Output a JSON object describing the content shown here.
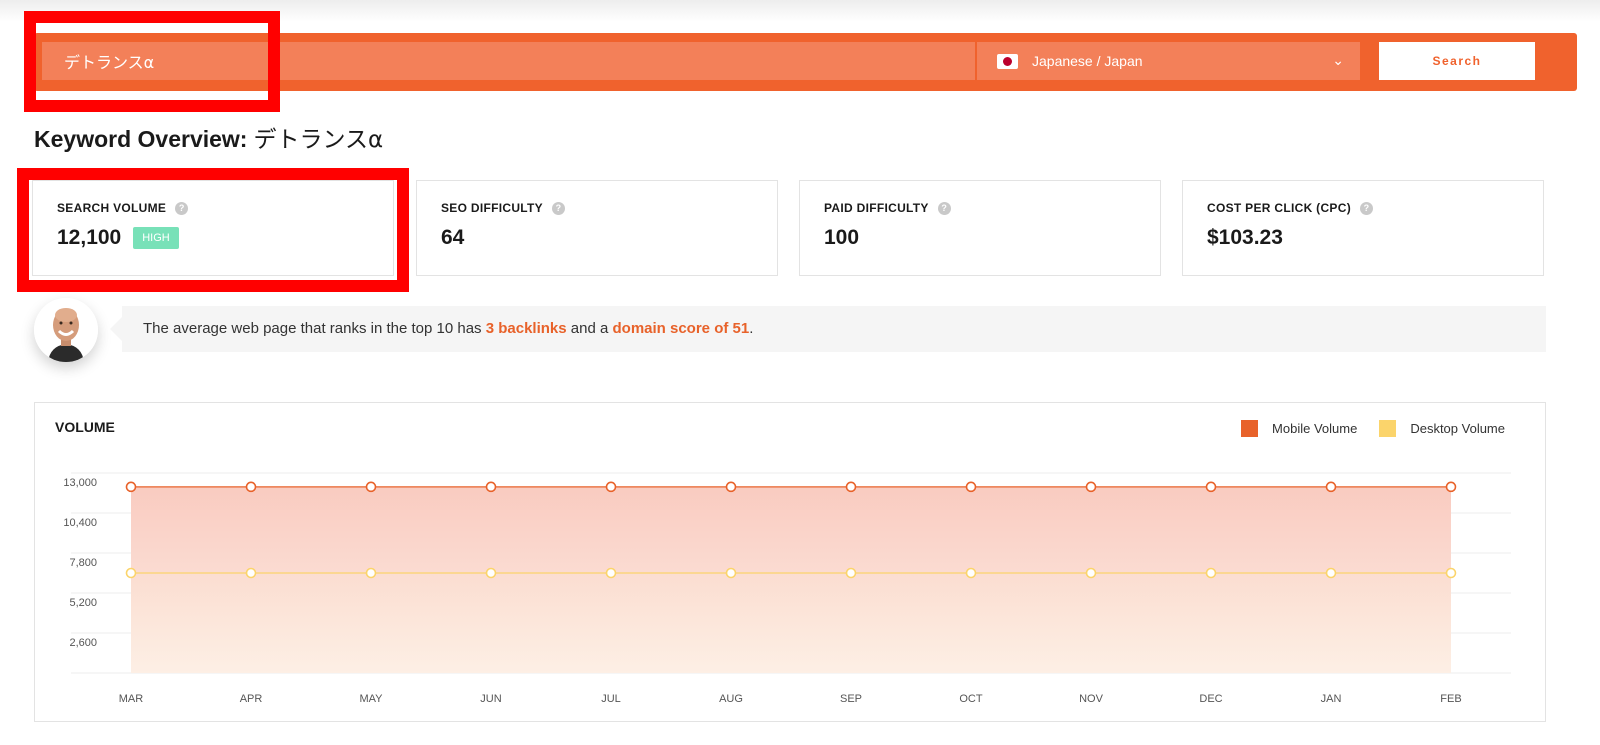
{
  "search": {
    "keyword": "デトランスα",
    "language": "Japanese / Japan",
    "button_label": "Search"
  },
  "title": {
    "prefix": "Keyword Overview:",
    "keyword": "デトランスα"
  },
  "metrics": [
    {
      "label": "SEARCH VOLUME",
      "value": "12,100",
      "badge": "HIGH"
    },
    {
      "label": "SEO DIFFICULTY",
      "value": "64"
    },
    {
      "label": "PAID DIFFICULTY",
      "value": "100"
    },
    {
      "label": "COST PER CLICK (CPC)",
      "value": "$103.23"
    }
  ],
  "tip": {
    "prefix": "The average web page that ranks in the top 10 has ",
    "backlinks": "3 backlinks",
    "middle": " and a ",
    "domain_score": "domain score of 51",
    "suffix": "."
  },
  "colors": {
    "accent": "#f0622d",
    "mobile": "#e8622a",
    "desktop": "#fbd46b",
    "badge": "#78e1b8"
  },
  "chart_data": {
    "type": "area",
    "title": "VOLUME",
    "categories": [
      "MAR",
      "APR",
      "MAY",
      "JUN",
      "JUL",
      "AUG",
      "SEP",
      "OCT",
      "NOV",
      "DEC",
      "JAN",
      "FEB"
    ],
    "y_ticks": [
      2600,
      5200,
      7800,
      10400,
      13000
    ],
    "y_tick_labels": [
      "2,600",
      "5,200",
      "7,800",
      "10,400",
      "13,000"
    ],
    "ylim": [
      0,
      13000
    ],
    "series": [
      {
        "name": "Mobile Volume",
        "color": "#e8622a",
        "values": [
          12100,
          12100,
          12100,
          12100,
          12100,
          12100,
          12100,
          12100,
          12100,
          12100,
          12100,
          12100
        ]
      },
      {
        "name": "Desktop Volume",
        "color": "#fbd46b",
        "values": [
          6500,
          6500,
          6500,
          6500,
          6500,
          6500,
          6500,
          6500,
          6500,
          6500,
          6500,
          6500
        ]
      }
    ],
    "legend": "top-right",
    "grid": true
  }
}
